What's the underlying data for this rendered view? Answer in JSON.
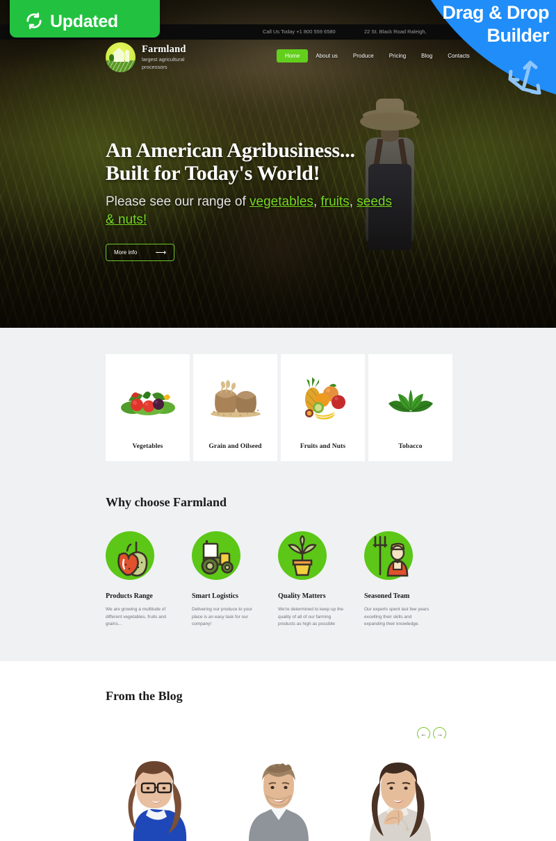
{
  "badge": {
    "label": "Updated",
    "icon": "sync-icon",
    "color": "#22c13f"
  },
  "promo": {
    "line1": "Drag & Drop",
    "line2": "Builder",
    "icon": "drag-arrows-icon",
    "color": "#1f8cf7"
  },
  "topbar": {
    "phone": "Call Us Today +1 800 559 6580",
    "address": "22 St. Black Road Raleigh,"
  },
  "brand": {
    "name": "Farmland",
    "tagline_line1": "largest agricultural",
    "tagline_line2": "processors",
    "logo_icon": "farm-logo-icon"
  },
  "nav": {
    "items": [
      {
        "label": "Home",
        "active": true
      },
      {
        "label": "About us",
        "active": false
      },
      {
        "label": "Produce",
        "active": false
      },
      {
        "label": "Pricing",
        "active": false
      },
      {
        "label": "Blog",
        "active": false
      },
      {
        "label": "Contacts",
        "active": false
      }
    ],
    "active_color": "#63cf1c"
  },
  "hero": {
    "title_line1": "An American Agribusiness...",
    "title_line2": "Built for Today's World!",
    "sub_prefix": "Please see our range of ",
    "links": [
      {
        "label": "vegetables"
      },
      {
        "label": "fruits"
      },
      {
        "label": "seeds & nuts!"
      }
    ],
    "sub_sep1": ",",
    "sub_sep2": ", ",
    "cta_label": "More info",
    "cta_icon": "arrow-right-icon",
    "link_color": "#77d820"
  },
  "products": {
    "cards": [
      {
        "label": "Vegetables",
        "art": "vegetables-image"
      },
      {
        "label": "Grain and Oilseed",
        "art": "grain-sack-image"
      },
      {
        "label": "Fruits and Nuts",
        "art": "fruits-image"
      },
      {
        "label": "Tobacco",
        "art": "tobacco-leaves-image"
      }
    ]
  },
  "why": {
    "heading": "Why choose Farmland",
    "features": [
      {
        "icon": "apple-pear-icon",
        "title": "Products Range",
        "text": "We are growing a multitude of different vegetables, fruits and grains..."
      },
      {
        "icon": "tractor-icon",
        "title": "Smart Logistics",
        "text": "Delivering our produce to your place is an easy task for our company!"
      },
      {
        "icon": "potted-plant-icon",
        "title": "Quality Matters",
        "text": "We're determined to keep up the quality of all of our farming products as high as possible"
      },
      {
        "icon": "farmer-pitchfork-icon",
        "title": "Seasoned Team",
        "text": "Our experts spent last few years excelling their skills and expanding their knowledge."
      }
    ]
  },
  "blog": {
    "heading": "From the Blog",
    "prev_label": "←",
    "next_label": "→",
    "posts": [
      {
        "image": "woman-with-glasses-portrait"
      },
      {
        "image": "smiling-man-portrait"
      },
      {
        "image": "woman-thinking-portrait"
      }
    ]
  }
}
